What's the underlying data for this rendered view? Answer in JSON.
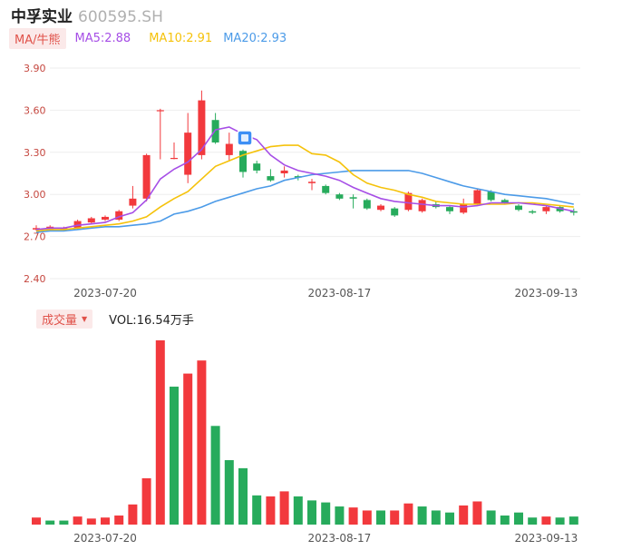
{
  "header": {
    "name": "中孚实业",
    "code": "600595.SH"
  },
  "indicators": {
    "ma_tab": "MA/牛熊",
    "ma5": "MA5:2.88",
    "ma10": "MA10:2.91",
    "ma20": "MA20:2.93"
  },
  "volume_header": {
    "tab": "成交量",
    "caret": "▼",
    "value": "VOL:16.54万手"
  },
  "colors": {
    "up": "#f2393d",
    "down": "#27ab5c",
    "ma5": "#a64ee6",
    "ma10": "#f5c20b",
    "ma20": "#4c9be8"
  },
  "chart_data": [
    {
      "type": "candlestick",
      "y_ticks": [
        "3.90",
        "3.60",
        "3.30",
        "3.00",
        "2.70",
        "2.40"
      ],
      "ylim": [
        2.4,
        3.9
      ],
      "x_ticks": [
        "2023-07-20",
        "2023-08-17",
        "2023-09-13"
      ],
      "candles": [
        {
          "o": 2.75,
          "c": 2.76,
          "h": 2.78,
          "l": 2.74
        },
        {
          "o": 2.75,
          "c": 2.77,
          "h": 2.78,
          "l": 2.74
        },
        {
          "o": 2.76,
          "c": 2.76,
          "h": 2.77,
          "l": 2.74
        },
        {
          "o": 2.76,
          "c": 2.81,
          "h": 2.82,
          "l": 2.75
        },
        {
          "o": 2.8,
          "c": 2.83,
          "h": 2.84,
          "l": 2.79
        },
        {
          "o": 2.82,
          "c": 2.84,
          "h": 2.85,
          "l": 2.81
        },
        {
          "o": 2.82,
          "c": 2.88,
          "h": 2.89,
          "l": 2.81
        },
        {
          "o": 2.92,
          "c": 2.97,
          "h": 3.06,
          "l": 2.9
        },
        {
          "o": 2.97,
          "c": 3.28,
          "h": 3.29,
          "l": 2.95
        },
        {
          "o": 3.6,
          "c": 3.6,
          "h": 3.61,
          "l": 3.25
        },
        {
          "o": 3.26,
          "c": 3.26,
          "h": 3.37,
          "l": 3.25
        },
        {
          "o": 3.14,
          "c": 3.44,
          "h": 3.58,
          "l": 3.08
        },
        {
          "o": 3.28,
          "c": 3.67,
          "h": 3.74,
          "l": 3.25
        },
        {
          "o": 3.53,
          "c": 3.37,
          "h": 3.58,
          "l": 3.36
        },
        {
          "o": 3.28,
          "c": 3.36,
          "h": 3.44,
          "l": 3.24
        },
        {
          "o": 3.31,
          "c": 3.16,
          "h": 3.32,
          "l": 3.12
        },
        {
          "o": 3.22,
          "c": 3.17,
          "h": 3.24,
          "l": 3.15
        },
        {
          "o": 3.13,
          "c": 3.1,
          "h": 3.18,
          "l": 3.09
        },
        {
          "o": 3.15,
          "c": 3.17,
          "h": 3.2,
          "l": 3.12
        },
        {
          "o": 3.13,
          "c": 3.12,
          "h": 3.14,
          "l": 3.1
        },
        {
          "o": 3.08,
          "c": 3.09,
          "h": 3.11,
          "l": 3.03
        },
        {
          "o": 3.06,
          "c": 3.01,
          "h": 3.07,
          "l": 3.0
        },
        {
          "o": 3.0,
          "c": 2.97,
          "h": 3.01,
          "l": 2.96
        },
        {
          "o": 2.98,
          "c": 2.97,
          "h": 3.0,
          "l": 2.9
        },
        {
          "o": 2.96,
          "c": 2.9,
          "h": 2.97,
          "l": 2.89
        },
        {
          "o": 2.89,
          "c": 2.92,
          "h": 2.93,
          "l": 2.88
        },
        {
          "o": 2.9,
          "c": 2.85,
          "h": 2.91,
          "l": 2.84
        },
        {
          "o": 2.89,
          "c": 3.01,
          "h": 3.02,
          "l": 2.88
        },
        {
          "o": 2.88,
          "c": 2.96,
          "h": 2.97,
          "l": 2.87
        },
        {
          "o": 2.93,
          "c": 2.91,
          "h": 2.95,
          "l": 2.9
        },
        {
          "o": 2.91,
          "c": 2.88,
          "h": 2.92,
          "l": 2.86
        },
        {
          "o": 2.87,
          "c": 2.93,
          "h": 2.97,
          "l": 2.86
        },
        {
          "o": 2.93,
          "c": 3.03,
          "h": 3.04,
          "l": 2.92
        },
        {
          "o": 3.02,
          "c": 2.96,
          "h": 3.03,
          "l": 2.95
        },
        {
          "o": 2.96,
          "c": 2.94,
          "h": 2.97,
          "l": 2.93
        },
        {
          "o": 2.92,
          "c": 2.89,
          "h": 2.93,
          "l": 2.88
        },
        {
          "o": 2.88,
          "c": 2.87,
          "h": 2.89,
          "l": 2.86
        },
        {
          "o": 2.88,
          "c": 2.91,
          "h": 2.92,
          "l": 2.86
        },
        {
          "o": 2.91,
          "c": 2.88,
          "h": 2.92,
          "l": 2.87
        },
        {
          "o": 2.88,
          "c": 2.87,
          "h": 2.9,
          "l": 2.85
        }
      ],
      "ma5": [
        2.75,
        2.76,
        2.76,
        2.78,
        2.79,
        2.8,
        2.84,
        2.87,
        2.96,
        3.11,
        3.18,
        3.23,
        3.32,
        3.46,
        3.48,
        3.43,
        3.39,
        3.28,
        3.21,
        3.17,
        3.15,
        3.13,
        3.1,
        3.05,
        3.01,
        2.97,
        2.95,
        2.94,
        2.93,
        2.92,
        2.92,
        2.91,
        2.92,
        2.94,
        2.94,
        2.94,
        2.93,
        2.92,
        2.9,
        2.88
      ],
      "ma10": [
        2.74,
        2.75,
        2.75,
        2.76,
        2.77,
        2.78,
        2.79,
        2.81,
        2.84,
        2.91,
        2.97,
        3.02,
        3.11,
        3.2,
        3.24,
        3.28,
        3.31,
        3.34,
        3.35,
        3.35,
        3.29,
        3.28,
        3.23,
        3.14,
        3.08,
        3.05,
        3.03,
        3.0,
        2.98,
        2.95,
        2.94,
        2.93,
        2.93,
        2.93,
        2.93,
        2.94,
        2.94,
        2.93,
        2.92,
        2.91
      ],
      "ma20": [
        2.73,
        2.74,
        2.74,
        2.75,
        2.76,
        2.77,
        2.77,
        2.78,
        2.79,
        2.81,
        2.86,
        2.88,
        2.91,
        2.95,
        2.98,
        3.01,
        3.04,
        3.06,
        3.1,
        3.12,
        3.14,
        3.15,
        3.16,
        3.17,
        3.17,
        3.17,
        3.17,
        3.17,
        3.15,
        3.12,
        3.09,
        3.06,
        3.04,
        3.02,
        3.0,
        2.99,
        2.98,
        2.97,
        2.95,
        2.93
      ]
    },
    {
      "type": "bar",
      "x_ticks": [
        "2023-07-20",
        "2023-08-17",
        "2023-09-13"
      ],
      "values": [
        0.7,
        0.4,
        0.4,
        0.8,
        0.6,
        0.7,
        0.9,
        2.0,
        4.6,
        18.3,
        13.7,
        15.0,
        16.3,
        9.8,
        6.4,
        5.6,
        2.9,
        2.8,
        3.3,
        2.8,
        2.4,
        2.2,
        1.8,
        1.7,
        1.4,
        1.4,
        1.4,
        2.1,
        1.8,
        1.4,
        1.2,
        1.9,
        2.3,
        1.4,
        0.9,
        1.2,
        0.7,
        0.8,
        0.7,
        0.8
      ],
      "up": [
        true,
        false,
        false,
        true,
        true,
        true,
        true,
        true,
        true,
        true,
        false,
        true,
        true,
        false,
        false,
        false,
        false,
        true,
        true,
        false,
        false,
        false,
        false,
        true,
        true,
        false,
        true,
        true,
        false,
        false,
        false,
        true,
        true,
        false,
        false,
        false,
        false,
        true,
        false,
        false
      ]
    }
  ]
}
